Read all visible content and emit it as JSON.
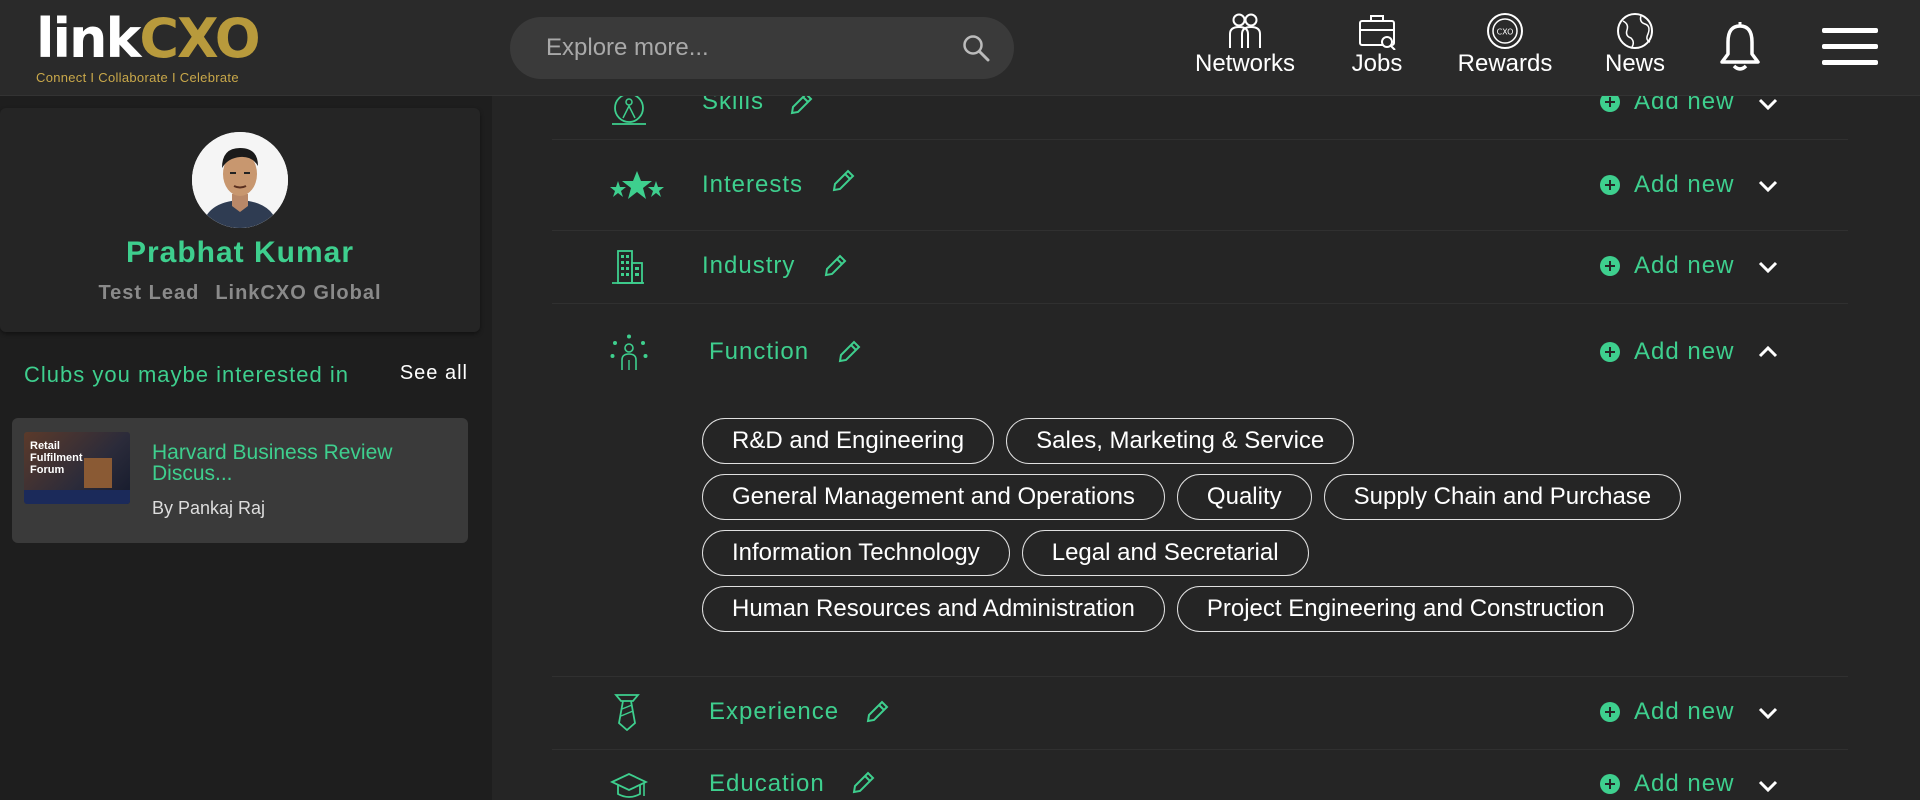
{
  "logo": {
    "text_main": "link",
    "text_accent": "CXO",
    "tagline": "Connect I Collaborate I Celebrate"
  },
  "search": {
    "placeholder": "Explore more..."
  },
  "nav": [
    {
      "label": "Networks",
      "icon": "networks-icon"
    },
    {
      "label": "Jobs",
      "icon": "jobs-icon"
    },
    {
      "label": "Rewards",
      "icon": "rewards-icon"
    },
    {
      "label": "News",
      "icon": "news-icon"
    }
  ],
  "profile": {
    "name": "Prabhat Kumar",
    "title": "Test Lead",
    "company": "LinkCXO Global"
  },
  "clubs": {
    "heading": "Clubs you maybe interested in",
    "see_all": "See all",
    "items": [
      {
        "thumb_text": "Retail Fulfilment Forum",
        "name": "Harvard Business Review Discus...",
        "by": "By Pankaj Raj"
      }
    ]
  },
  "sections": {
    "add_new_label": "Add new",
    "skills": "Skills",
    "interests": "Interests",
    "industry": "Industry",
    "function": "Function",
    "experience": "Experience",
    "education": "Education"
  },
  "function_chips": [
    [
      "R&D and Engineering",
      "Sales, Marketing & Service"
    ],
    [
      "General Management and Operations",
      "Quality",
      "Supply Chain and Purchase"
    ],
    [
      "Information Technology",
      "Legal and Secretarial"
    ],
    [
      "Human Resources and Administration",
      "Project Engineering and Construction"
    ]
  ],
  "colors": {
    "accent_green": "#3ecf8e",
    "logo_gold": "#b89a3c",
    "background": "#1e1e1e",
    "card": "#252525"
  }
}
